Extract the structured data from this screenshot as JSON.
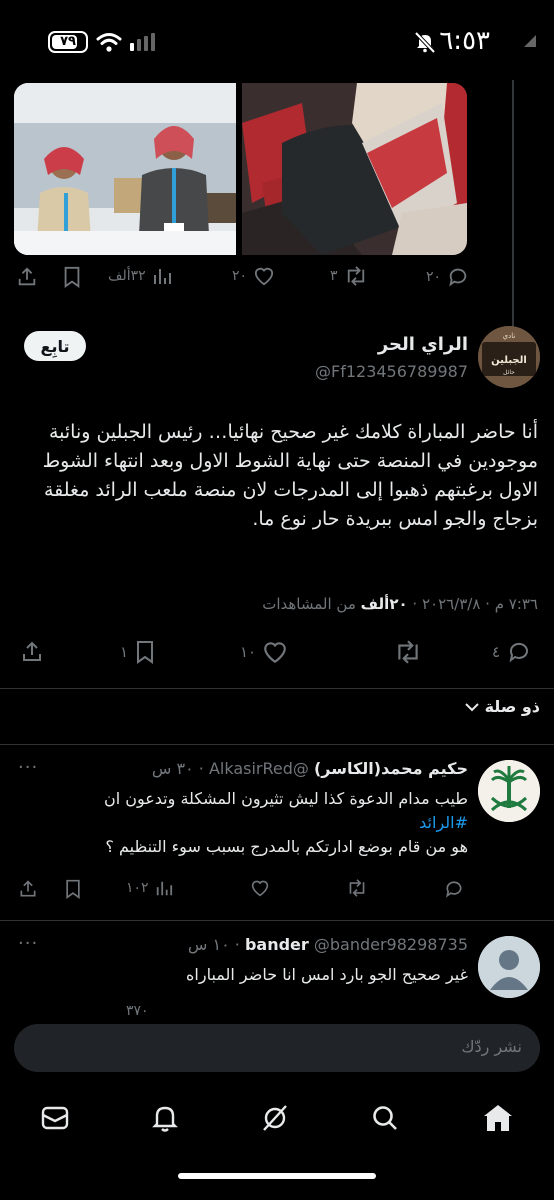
{
  "status_bar": {
    "battery": "٧٩",
    "battery_level": 0.79,
    "time": "٦:٥٣"
  },
  "prev_tweet": {
    "actions": {
      "reply_count": "٢٠",
      "retweet_count": "٣",
      "like_count": "٢٠",
      "views_count": "٣٢ألف"
    }
  },
  "main_tweet": {
    "display_name": "الراي الحر",
    "handle": "@Ff123456789987",
    "follow_label": "تابِع",
    "avatar_text": "نادي الجبلين",
    "text": "أنا حاضر المباراة كلامك غير صحيح نهائيا… رئيس الجبلين ونائبة موجودين في المنصة حتى نهاية الشوط الاول وبعد انتهاء الشوط الاول برغبتهم ذهبوا إلى المدرجات لان منصة ملعب الرائد مغلقة بزجاج والجو امس ببريدة حار نوع ما.",
    "timestamp": "٧:٣٦ م · ٢٠٢٦/٣/٨ ·",
    "views_number": "٢٠ألف",
    "views_suffix": "من المشاهدات",
    "actions": {
      "reply_count": "٤",
      "retweet_count": "",
      "like_count": "١٠",
      "bookmark_count": "١"
    }
  },
  "sort": {
    "label": "ذو صلة"
  },
  "replies": [
    {
      "display_name": "حكيم محمد(الكاسر)",
      "handle": "@AlkasirRed",
      "time": "٣٠ س",
      "line1": "طيب مدام الدعوة كذا ليش تثيرون المشكلة وتدعون ان",
      "hashtag": "#الرائد",
      "line3": "هو من قام بوضع ادارتكم بالمدرج بسبب سوء التنظيم ؟",
      "views_count": "١٠٢"
    },
    {
      "display_name": "bander",
      "handle": "@bander98298735",
      "time": "١٠ س",
      "line1": "غير صحيح الجو بارد امس انا حاضر المباراه",
      "views_count": "٣٧٠"
    }
  ],
  "compose": {
    "placeholder": "نشر ردّك"
  },
  "colors": {
    "accent": "#1d9bf0",
    "background": "#000000",
    "muted": "#71767b",
    "text": "#e7e9ea"
  },
  "tabbar": {
    "icons": [
      "mail-icon",
      "bell-icon",
      "grok-icon",
      "search-icon",
      "home-icon"
    ]
  }
}
